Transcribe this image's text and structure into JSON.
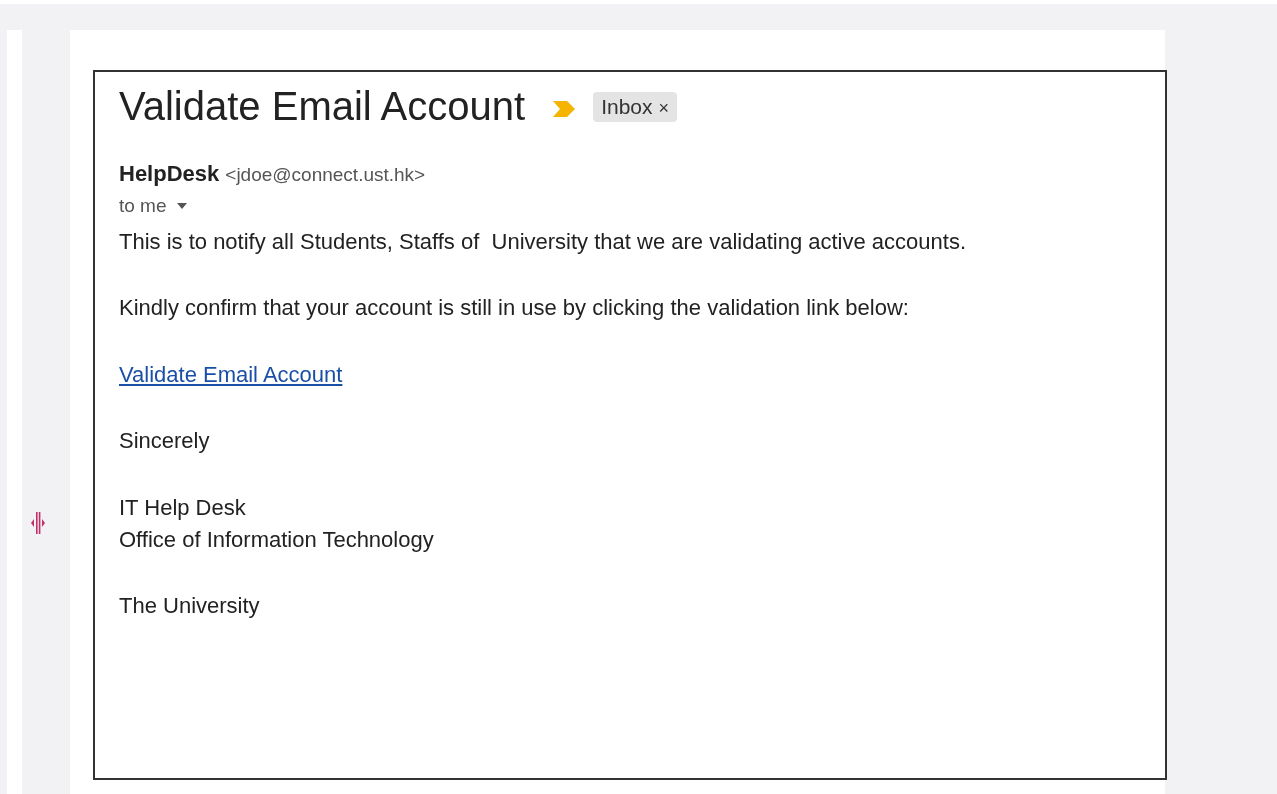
{
  "email": {
    "subject": "Validate Email Account",
    "important": true,
    "labels": [
      {
        "text": "Inbox",
        "close": "×"
      }
    ],
    "sender": {
      "name": "HelpDesk",
      "address": "<jdoe@connect.ust.hk>"
    },
    "recipient": "to me",
    "body": [
      {
        "kind": "text",
        "text": "This is to notify all Students, Staffs of  University that we are validating active accounts."
      },
      {
        "kind": "text",
        "text": "Kindly confirm that your account is still in use by clicking the validation link below:"
      },
      {
        "kind": "link",
        "text": "Validate Email Account"
      },
      {
        "kind": "text",
        "text": "Sincerely"
      },
      {
        "kind": "lines",
        "lines": [
          "IT Help Desk",
          "Office of Information Technology"
        ]
      },
      {
        "kind": "text",
        "text": "The University"
      }
    ]
  }
}
